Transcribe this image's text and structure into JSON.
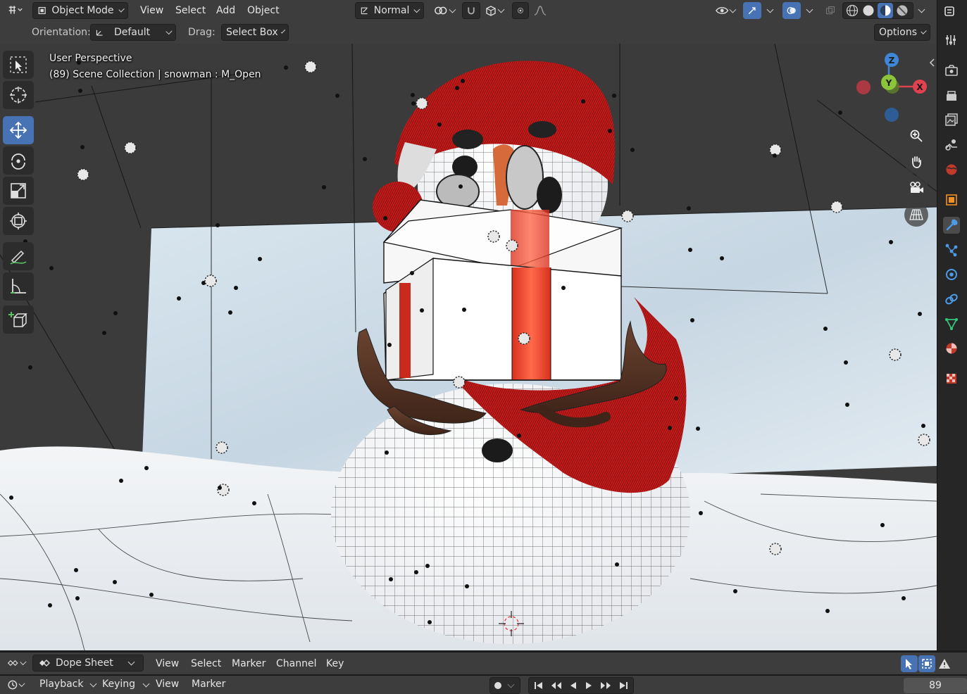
{
  "header": {
    "mode_label": "Object Mode",
    "menus": [
      "View",
      "Select",
      "Add",
      "Object"
    ],
    "orientation_mode_label": "Normal",
    "options_label": "Options"
  },
  "tool_header": {
    "orientation_label": "Orientation:",
    "orientation_value": "Default",
    "drag_label": "Drag:",
    "drag_value": "Select Box"
  },
  "viewport": {
    "perspective_label": "User Perspective",
    "collection_info": "(89) Scene Collection | snowman : M_Open",
    "gizmo": {
      "z_label": "Z",
      "x_label": "X",
      "y_label": "Y"
    }
  },
  "dope_sheet": {
    "mode_label": "Dope Sheet",
    "menus": [
      "View",
      "Select",
      "Marker",
      "Channel",
      "Key"
    ]
  },
  "timeline": {
    "playback_label": "Playback",
    "keying_label": "Keying",
    "menus": [
      "View",
      "Marker"
    ],
    "current_frame": "89"
  },
  "colors": {
    "accent": "#4772b3",
    "header_bg": "#3d3d3d",
    "axis_x": "#e0424f",
    "axis_y": "#8cc43a",
    "axis_z": "#3f86d6"
  }
}
